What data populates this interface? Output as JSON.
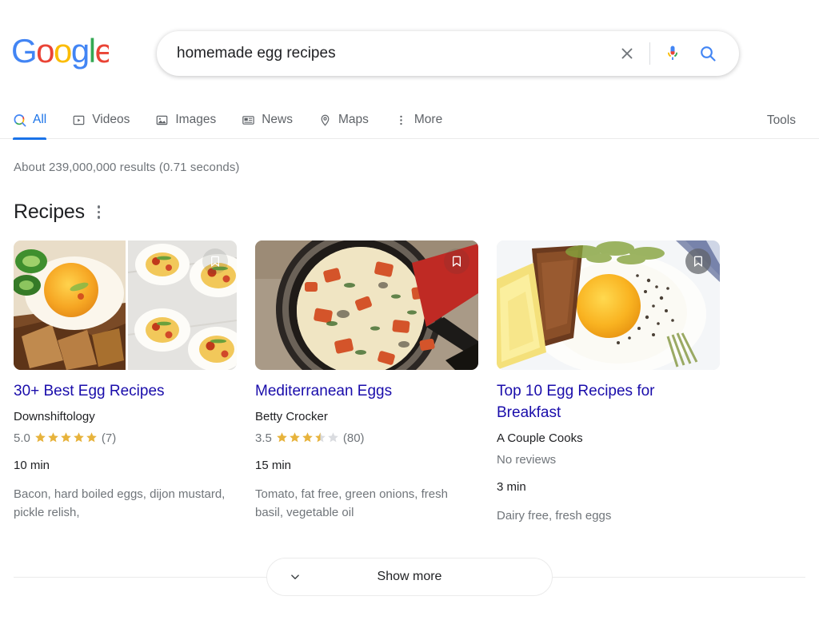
{
  "brand": {
    "logo_text": "Google",
    "logo_colors": [
      "#4285F4",
      "#EA4335",
      "#FBBC05",
      "#4285F4",
      "#34A853",
      "#EA4335"
    ]
  },
  "search": {
    "query": "homemade egg recipes",
    "placeholder": "Search",
    "clear_label": "Clear",
    "voice_label": "Search by voice",
    "submit_label": "Google Search"
  },
  "nav": {
    "tabs": [
      {
        "label": "All",
        "icon": "search-icon",
        "active": true
      },
      {
        "label": "Videos",
        "icon": "video-icon",
        "active": false
      },
      {
        "label": "Images",
        "icon": "image-icon",
        "active": false
      },
      {
        "label": "News",
        "icon": "news-icon",
        "active": false
      },
      {
        "label": "Maps",
        "icon": "map-pin-icon",
        "active": false
      },
      {
        "label": "More",
        "icon": "kebab-icon",
        "active": false
      }
    ],
    "tools_label": "Tools"
  },
  "results": {
    "stats": "About 239,000,000 results (0.71 seconds)",
    "section_title": "Recipes",
    "show_more_label": "Show more",
    "cards": [
      {
        "title": "30+ Best Egg Recipes",
        "site": "Downshiftology",
        "rating_value": "5.0",
        "rating_stars": 5.0,
        "review_count": "(7)",
        "no_reviews": "",
        "time": "10 min",
        "ingredients": "Bacon, hard boiled eggs, dijon mustard, pickle relish,",
        "save_label": "Save",
        "save_style": "plain"
      },
      {
        "title": "Mediterranean Eggs",
        "site": "Betty Crocker",
        "rating_value": "3.5",
        "rating_stars": 3.5,
        "review_count": "(80)",
        "no_reviews": "",
        "time": "15 min",
        "ingredients": "Tomato, fat free, green onions, fresh basil, vegetable oil",
        "save_label": "Save",
        "save_style": "plain"
      },
      {
        "title": "Top 10 Egg Recipes for Breakfast",
        "site": "A Couple Cooks",
        "rating_value": "",
        "rating_stars": 0,
        "review_count": "",
        "no_reviews": "No reviews",
        "time": "3 min",
        "ingredients": "Dairy free, fresh eggs",
        "save_label": "Save",
        "save_style": "solid"
      }
    ]
  },
  "colors": {
    "link": "#1a0dab",
    "accent": "#1a73e8",
    "star": "#e7b33c",
    "star_empty": "#dadce0",
    "text": "#202124",
    "muted": "#70757a"
  }
}
